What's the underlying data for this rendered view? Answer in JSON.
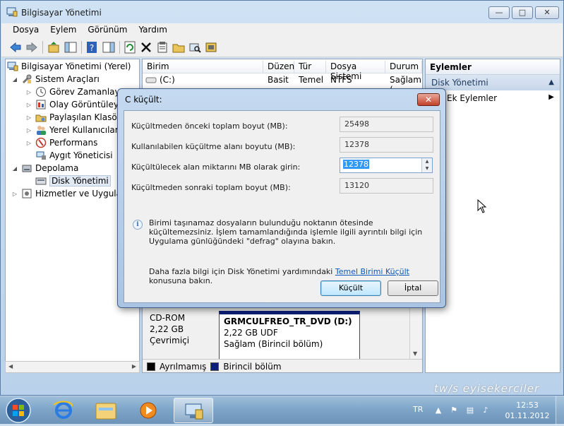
{
  "window": {
    "title": "Bilgisayar Yönetimi",
    "controls": {
      "minimize": "—",
      "maximize": "□",
      "close": "✕"
    }
  },
  "menu": [
    "Dosya",
    "Eylem",
    "Görünüm",
    "Yardım"
  ],
  "tree": {
    "items": [
      {
        "label": "Bilgisayar Yönetimi (Yerel)"
      },
      {
        "label": "Sistem Araçları"
      },
      {
        "label": "Görev Zamanlayıcı"
      },
      {
        "label": "Olay Görüntüleyici"
      },
      {
        "label": "Paylaşılan Klasörler"
      },
      {
        "label": "Yerel Kullanıcılar ve"
      },
      {
        "label": "Performans"
      },
      {
        "label": "Aygıt Yöneticisi"
      },
      {
        "label": "Depolama"
      },
      {
        "label": "Disk Yönetimi"
      },
      {
        "label": "Hizmetler ve Uygulam"
      }
    ]
  },
  "volumes": {
    "headers": [
      "Birim",
      "Düzen",
      "Tür",
      "Dosya Sistemi",
      "Durum"
    ],
    "rows": [
      {
        "birim": "(C:)",
        "duzen": "Basit",
        "tur": "Temel",
        "fs": "NTFS",
        "durum": "Sağlam ("
      }
    ]
  },
  "disk": {
    "label_line1": "CD-ROM",
    "label_line2": "2,22 GB",
    "label_line3": "Çevrimiçi",
    "volume_name": "GRMCULFREO_TR_DVD  (D:)",
    "volume_size": "2,22 GB UDF",
    "volume_status": "Sağlam (Birincil bölüm)"
  },
  "legend": {
    "unallocated": "Ayrılmamış",
    "primary": "Birincil bölüm",
    "unallocated_color": "#000000",
    "primary_color": "#0c1f7a"
  },
  "actions": {
    "header": "Eylemler",
    "section": "Disk Yönetimi",
    "more": "Ek Eylemler"
  },
  "dialog": {
    "title": "C küçült:",
    "close": "✕",
    "fields": [
      {
        "label": "Küçültmeden önceki toplam boyut (MB):",
        "value": "25498"
      },
      {
        "label": "Kullanılabilen küçültme alanı boyutu (MB):",
        "value": "12378"
      },
      {
        "label": "Küçültülecek alan miktarını MB olarak girin:",
        "value": "12378"
      },
      {
        "label": "Küçültmeden sonraki toplam boyut (MB):",
        "value": "13120"
      }
    ],
    "info": "Birimi taşınamaz dosyaların bulunduğu noktanın ötesinde küçültemezsiniz. İşlem tamamlandığında işlemle ilgili ayrıntılı bilgi için Uygulama günlüğündeki \"defrag\" olayına bakın.",
    "more_prefix": "Daha fazla bilgi için Disk Yönetimi yardımındaki ",
    "more_link": "Temel Birimi Küçült",
    "more_suffix": " konusuna bakın.",
    "ok": "Küçült",
    "cancel": "İptal"
  },
  "taskbar": {
    "lang": "TR",
    "time": "12:53",
    "date": "01.11.2012"
  },
  "watermark": "tw/s  eyisekerciler"
}
